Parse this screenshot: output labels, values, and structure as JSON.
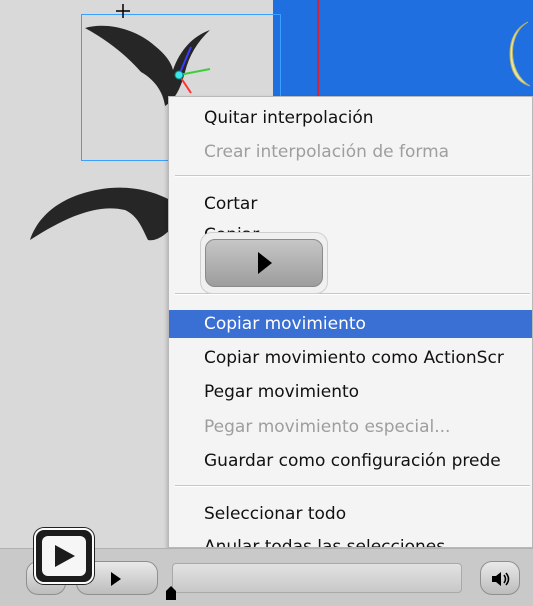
{
  "context_menu": {
    "items": [
      {
        "label": "Quitar interpolación",
        "state": "enabled"
      },
      {
        "label": "Crear interpolación de forma",
        "state": "disabled"
      },
      {
        "label": "Cortar",
        "state": "enabled"
      },
      {
        "label": "Copiar",
        "state": "enabled"
      },
      {
        "label": "Copiar movimiento",
        "state": "selected"
      },
      {
        "label": "Copiar movimiento como ActionScr",
        "state": "enabled"
      },
      {
        "label": "Pegar movimiento",
        "state": "enabled"
      },
      {
        "label": "Pegar movimiento especial...",
        "state": "disabled"
      },
      {
        "label": "Guardar como configuración prede",
        "state": "enabled"
      },
      {
        "label": "Seleccionar todo",
        "state": "enabled"
      },
      {
        "label": "Anular todas las selecciones",
        "state": "enabled"
      }
    ]
  },
  "icons": {
    "overlay_play": "play-icon",
    "player_play": "play-icon",
    "volume": "speaker-icon",
    "crosshair": "crosshair-icon",
    "transform_gizmo": "3d-rotate-icon"
  },
  "colors": {
    "selection_highlight": "#3a6fd3",
    "stage_blue": "#1f6fe0",
    "bounding_box": "#39a0ff",
    "guide_red": "#d1233a"
  }
}
